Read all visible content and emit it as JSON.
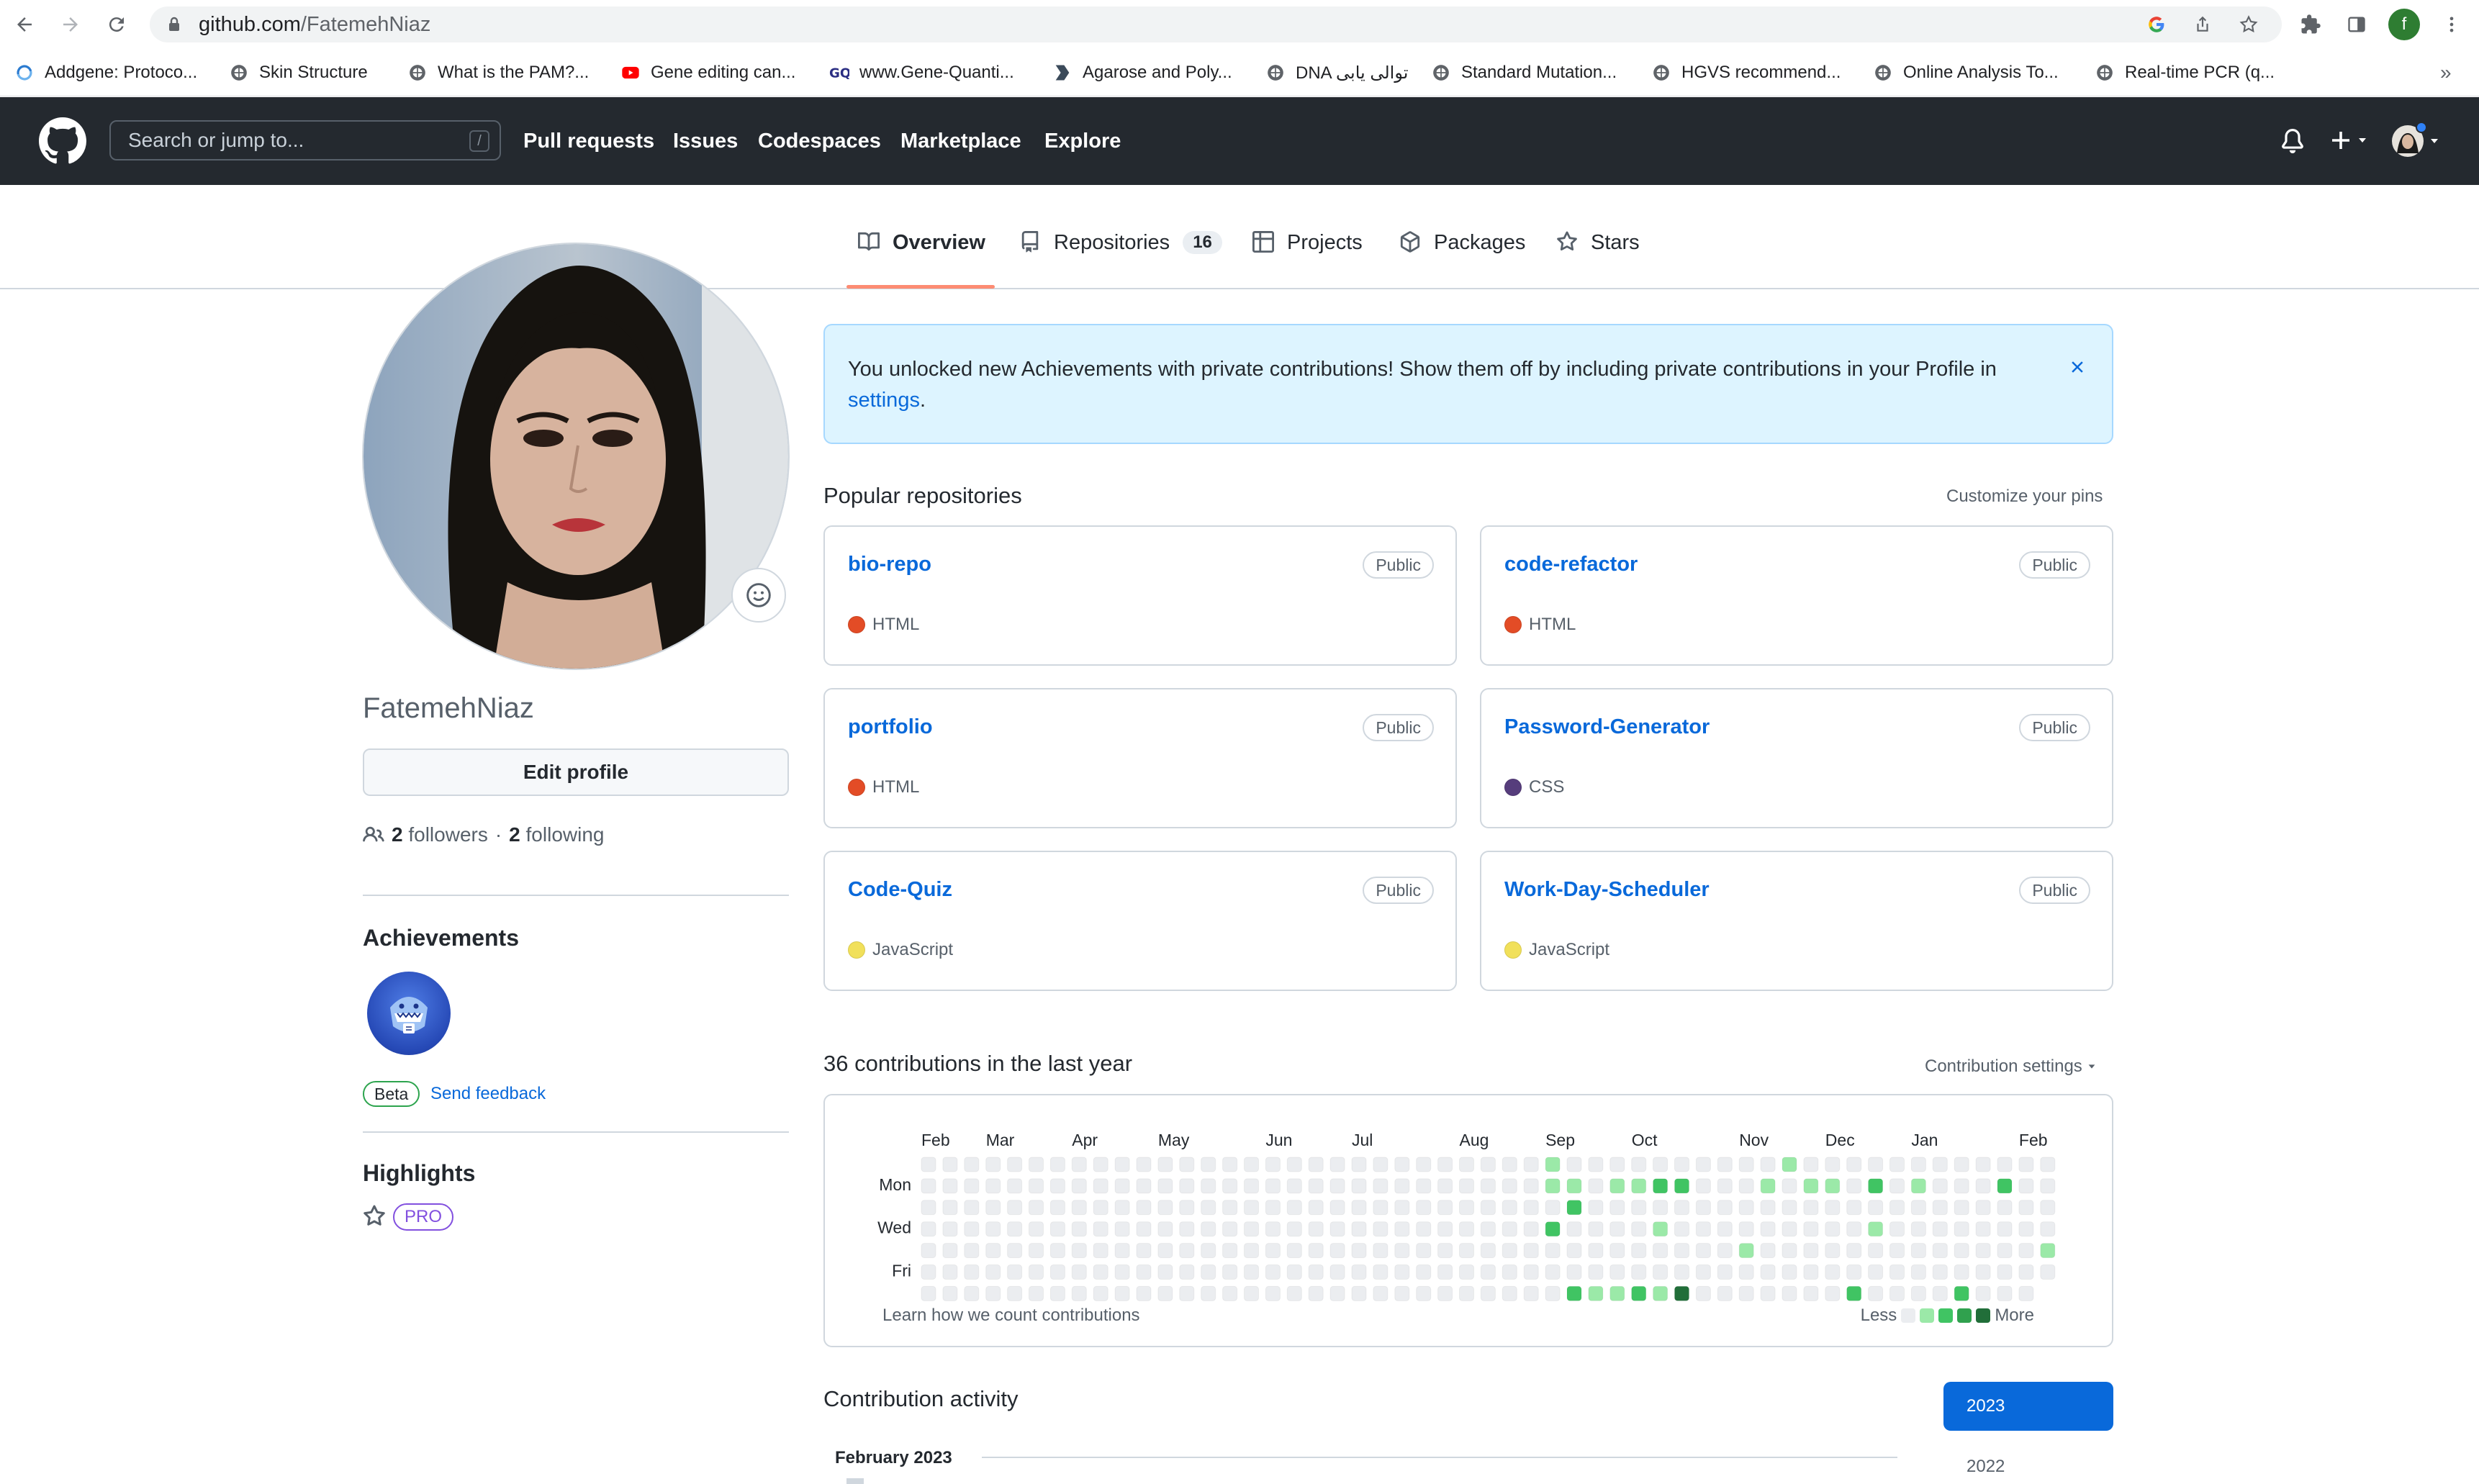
{
  "browser": {
    "url_host": "github.com",
    "url_path": "/FatemehNiaz",
    "profile_initial": "f",
    "bookmarks": [
      {
        "label": "Addgene: Protoco...",
        "icon": "addgene-icon"
      },
      {
        "label": "Skin Structure",
        "icon": "globe-icon"
      },
      {
        "label": "What is the PAM?...",
        "icon": "globe-icon"
      },
      {
        "label": "Gene editing can...",
        "icon": "youtube-icon"
      },
      {
        "label": "www.Gene-Quanti...",
        "icon": "gq-icon"
      },
      {
        "label": "Agarose and Poly...",
        "icon": "bookmark-flag-icon"
      },
      {
        "label": "DNA توالی یابی",
        "icon": "globe-icon"
      },
      {
        "label": "Standard Mutation...",
        "icon": "globe-icon"
      },
      {
        "label": "HGVS recommend...",
        "icon": "globe-icon"
      },
      {
        "label": "Online Analysis To...",
        "icon": "globe-icon"
      },
      {
        "label": "Real-time PCR (q...",
        "icon": "globe-icon"
      }
    ],
    "bookmarks_overflow": "»"
  },
  "header": {
    "search_placeholder": "Search or jump to...",
    "search_shortcut": "/",
    "nav": [
      "Pull requests",
      "Issues",
      "Codespaces",
      "Marketplace",
      "Explore"
    ]
  },
  "tabs": [
    {
      "label": "Overview",
      "icon": "book-icon",
      "active": true
    },
    {
      "label": "Repositories",
      "icon": "repo-icon",
      "count": "16"
    },
    {
      "label": "Projects",
      "icon": "table-icon"
    },
    {
      "label": "Packages",
      "icon": "package-icon"
    },
    {
      "label": "Stars",
      "icon": "star-icon"
    }
  ],
  "profile": {
    "username": "FatemehNiaz",
    "edit_label": "Edit profile",
    "followers_count": "2",
    "followers_label": "followers",
    "separator": "·",
    "following_count": "2",
    "following_label": "following",
    "achievements_title": "Achievements",
    "beta_label": "Beta",
    "send_feedback": "Send feedback",
    "highlights_title": "Highlights",
    "pro_label": "PRO"
  },
  "banner": {
    "text_before": "You unlocked new Achievements with private contributions! Show them off by including private contributions in your Profile in ",
    "link": "settings",
    "text_after": "."
  },
  "popular": {
    "title": "Popular repositories",
    "customize": "Customize your pins",
    "repos": [
      {
        "name": "bio-repo",
        "visibility": "Public",
        "language": "HTML",
        "color": "#e34c26"
      },
      {
        "name": "code-refactor",
        "visibility": "Public",
        "language": "HTML",
        "color": "#e34c26"
      },
      {
        "name": "portfolio",
        "visibility": "Public",
        "language": "HTML",
        "color": "#e34c26"
      },
      {
        "name": "Password-Generator",
        "visibility": "Public",
        "language": "CSS",
        "color": "#563d7c"
      },
      {
        "name": "Code-Quiz",
        "visibility": "Public",
        "language": "JavaScript",
        "color": "#f1e05a"
      },
      {
        "name": "Work-Day-Scheduler",
        "visibility": "Public",
        "language": "JavaScript",
        "color": "#f1e05a"
      }
    ]
  },
  "contributions": {
    "title": "36 contributions in the last year",
    "settings_label": "Contribution settings",
    "months": [
      "Feb",
      "Mar",
      "Apr",
      "May",
      "Jun",
      "Jul",
      "Aug",
      "Sep",
      "Oct",
      "Nov",
      "Dec",
      "Jan",
      "Feb"
    ],
    "days": [
      "Mon",
      "Wed",
      "Fri"
    ],
    "learn_link": "Learn how we count contributions",
    "less": "Less",
    "more": "More",
    "colors": [
      "#ebedf0",
      "#9be9a8",
      "#40c463",
      "#30a14e",
      "#216e39"
    ],
    "levels": [
      [
        29,
        0,
        1
      ],
      [
        29,
        1,
        1
      ],
      [
        29,
        2,
        0
      ],
      [
        29,
        3,
        2
      ],
      [
        29,
        4,
        0
      ],
      [
        29,
        5,
        0
      ],
      [
        29,
        6,
        0
      ],
      [
        30,
        1,
        1
      ],
      [
        30,
        2,
        2
      ],
      [
        30,
        6,
        2
      ],
      [
        31,
        6,
        1
      ],
      [
        32,
        1,
        1
      ],
      [
        32,
        6,
        1
      ],
      [
        33,
        1,
        1
      ],
      [
        33,
        6,
        2
      ],
      [
        34,
        1,
        2
      ],
      [
        34,
        3,
        1
      ],
      [
        34,
        6,
        1
      ],
      [
        35,
        1,
        2
      ],
      [
        35,
        6,
        4
      ],
      [
        38,
        4,
        1
      ],
      [
        39,
        1,
        1
      ],
      [
        40,
        0,
        1
      ],
      [
        41,
        1,
        1
      ],
      [
        42,
        1,
        1
      ],
      [
        43,
        6,
        2
      ],
      [
        44,
        1,
        2
      ],
      [
        44,
        3,
        1
      ],
      [
        46,
        1,
        1
      ],
      [
        48,
        6,
        2
      ],
      [
        50,
        1,
        2
      ],
      [
        52,
        4,
        1
      ]
    ]
  },
  "activity": {
    "title": "Contribution activity",
    "years": [
      "2023",
      "2022"
    ],
    "month_heading": "February 2023"
  }
}
